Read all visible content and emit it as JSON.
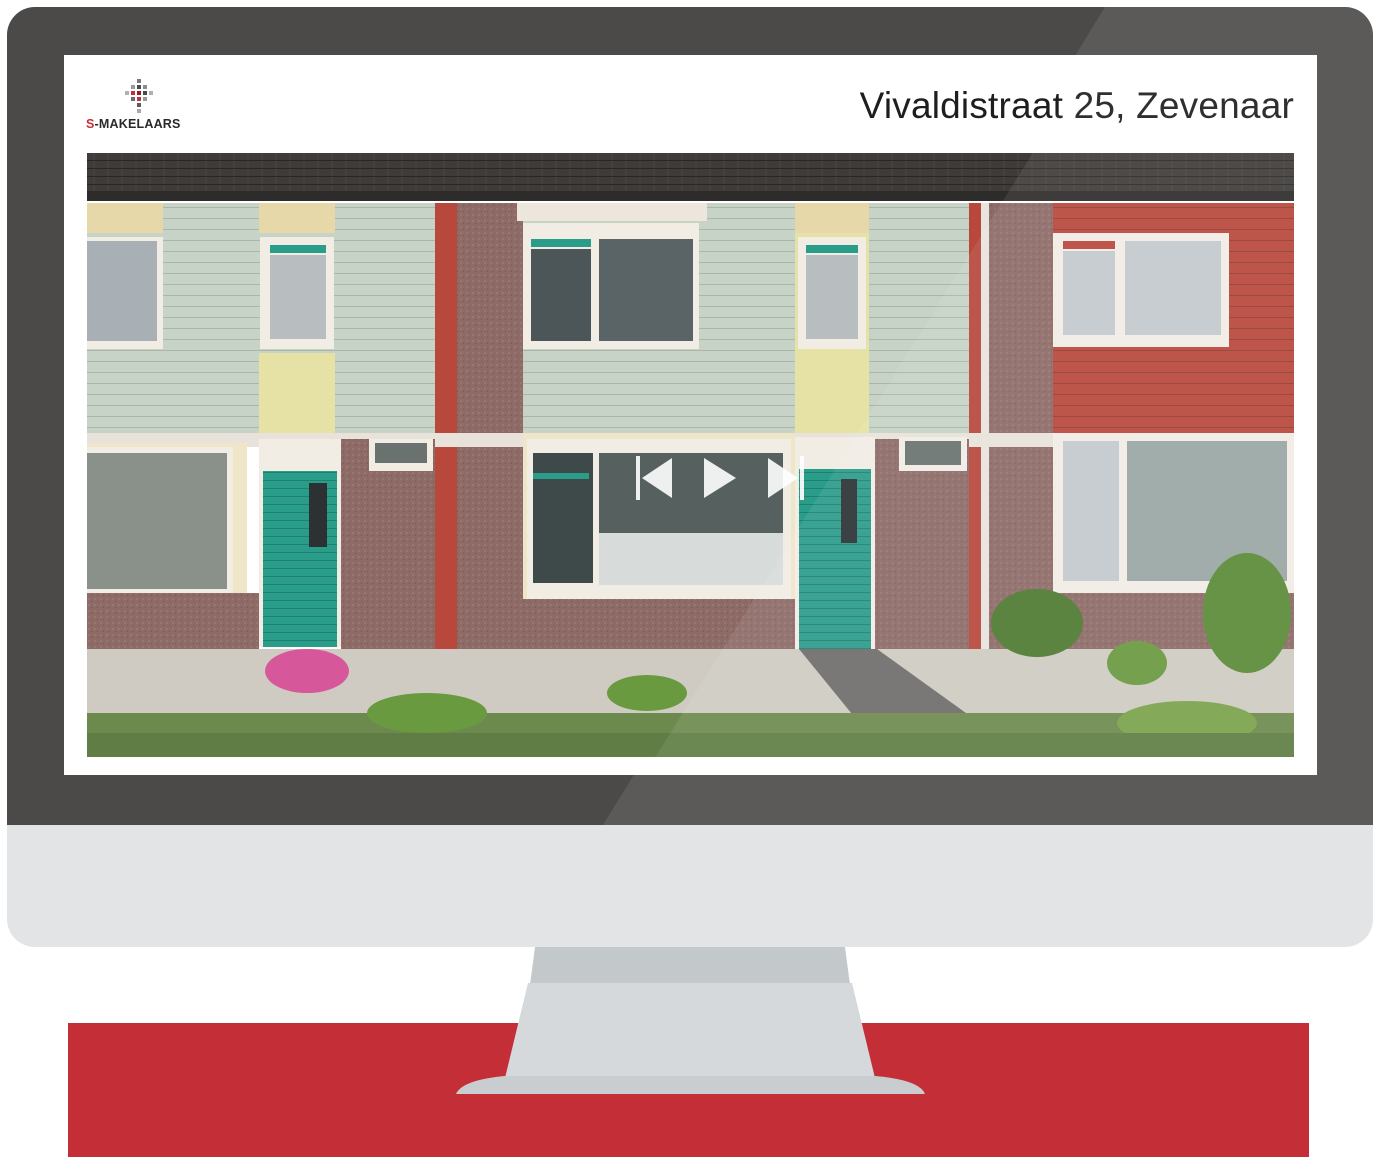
{
  "page": {
    "logo": {
      "prefix": "S",
      "rest": "-MAKELAARS",
      "icon": "s-makelaars-logo-icon"
    },
    "title": "Vivaldistraat 25, Zevenaar"
  },
  "player": {
    "controls": [
      {
        "name": "previous-button",
        "icon": "skip-previous-icon"
      },
      {
        "name": "play-button",
        "icon": "play-icon"
      },
      {
        "name": "next-button",
        "icon": "skip-next-icon"
      }
    ]
  },
  "colors": {
    "brand_red": "#c42f37",
    "bezel": "#4b4a49",
    "monitor_body": "#e3e4e6",
    "door_green": "#2a9c8a"
  }
}
